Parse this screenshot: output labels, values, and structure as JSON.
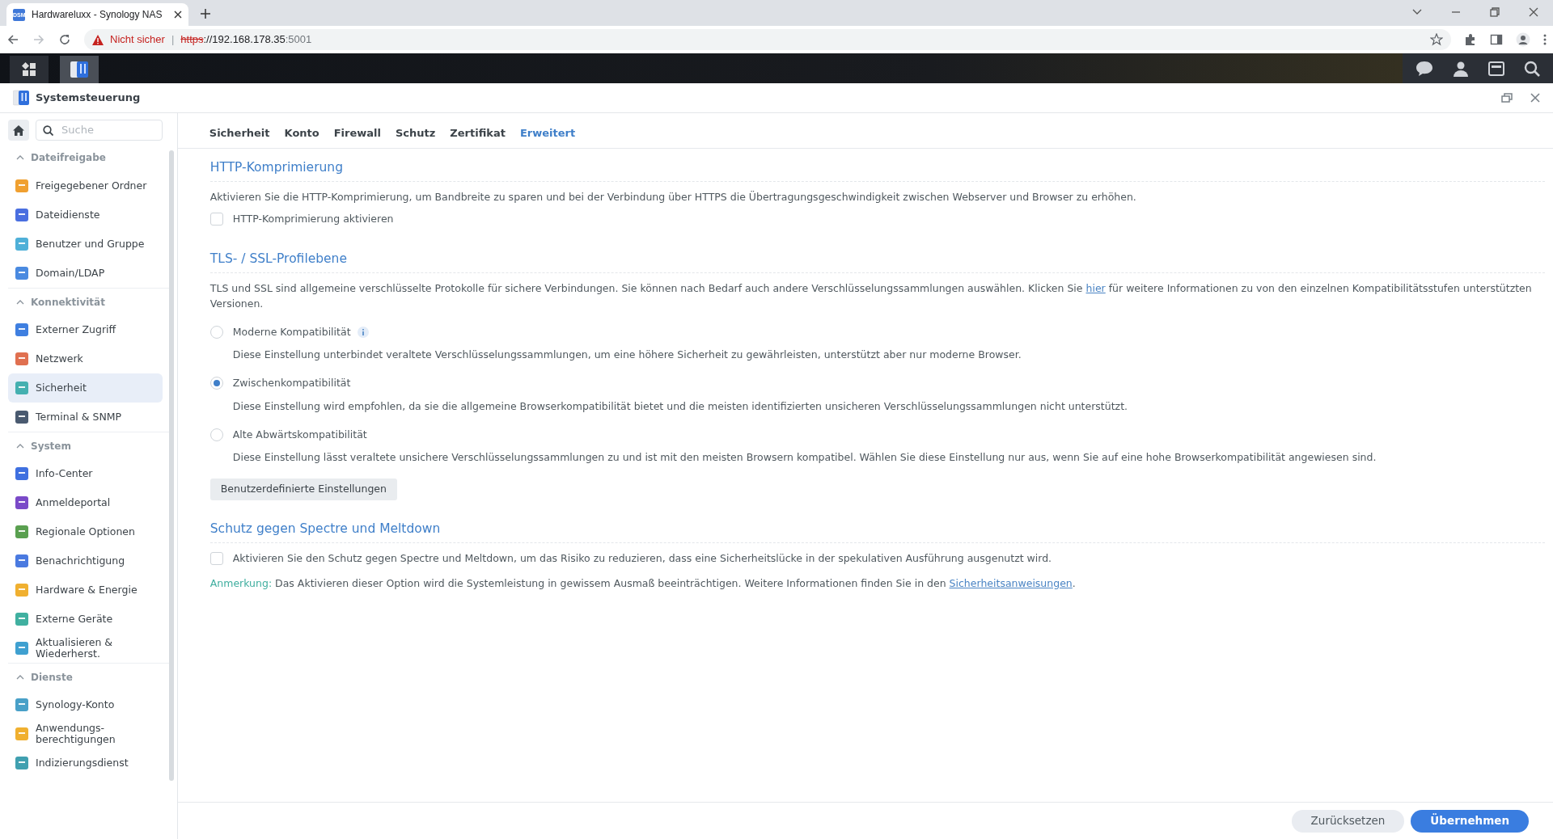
{
  "browser": {
    "tab": {
      "favicon": "DSM",
      "title": "Hardwareluxx - Synology NAS"
    },
    "address_bar": {
      "security_label": "Nicht sicher",
      "separator": "|",
      "url_scheme": "https",
      "url_host": "://192.168.178.35",
      "url_port": ":5001"
    }
  },
  "window": {
    "title": "Systemsteuerung"
  },
  "sidebar": {
    "search": {
      "placeholder": "Suche"
    },
    "sections": [
      {
        "title": "Dateifreigabe",
        "expanded": true,
        "items": [
          {
            "label": "Freigegebener Ordner",
            "selected": false
          },
          {
            "label": "Dateidienste",
            "selected": false
          },
          {
            "label": "Benutzer und Gruppe",
            "selected": false
          },
          {
            "label": "Domain/LDAP",
            "selected": false
          }
        ]
      },
      {
        "title": "Konnektivität",
        "expanded": true,
        "items": [
          {
            "label": "Externer Zugriff",
            "selected": false
          },
          {
            "label": "Netzwerk",
            "selected": false
          },
          {
            "label": "Sicherheit",
            "selected": true
          },
          {
            "label": "Terminal & SNMP",
            "selected": false
          }
        ]
      },
      {
        "title": "System",
        "expanded": true,
        "items": [
          {
            "label": "Info-Center",
            "selected": false
          },
          {
            "label": "Anmeldeportal",
            "selected": false
          },
          {
            "label": "Regionale Optionen",
            "selected": false
          },
          {
            "label": "Benachrichtigung",
            "selected": false
          },
          {
            "label": "Hardware & Energie",
            "selected": false
          },
          {
            "label": "Externe Geräte",
            "selected": false
          },
          {
            "label": "Aktualisieren & Wiederherst.",
            "selected": false
          }
        ]
      },
      {
        "title": "Dienste",
        "expanded": true,
        "items": [
          {
            "label": "Synology-Konto",
            "selected": false
          },
          {
            "label": "Anwendungs-berechtigungen",
            "selected": false
          },
          {
            "label": "Indizierungsdienst",
            "selected": false
          }
        ]
      }
    ]
  },
  "tabs": [
    {
      "label": "Sicherheit",
      "selected": false
    },
    {
      "label": "Konto",
      "selected": false
    },
    {
      "label": "Firewall",
      "selected": false
    },
    {
      "label": "Schutz",
      "selected": false
    },
    {
      "label": "Zertifikat",
      "selected": false
    },
    {
      "label": "Erweitert",
      "selected": true
    }
  ],
  "http_compression": {
    "title": "HTTP-Komprimierung",
    "description": "Aktivieren Sie die HTTP-Komprimierung, um Bandbreite zu sparen und bei der Verbindung über HTTPS die Übertragungsgeschwindigkeit zwischen Webserver und Browser zu erhöhen.",
    "checkbox": {
      "label": "HTTP-Komprimierung aktivieren",
      "checked": false
    }
  },
  "tls_profile": {
    "title": "TLS- / SSL-Profilebene",
    "description": {
      "before": "TLS und SSL sind allgemeine verschlüsselte Protokolle für sichere Verbindungen. Sie können nach Bedarf auch andere Verschlüsselungssammlungen auswählen. Klicken Sie ",
      "link": "hier",
      "after": " für weitere Informationen zu von den einzelnen Kompatibilitätsstufen unterstützten Versionen."
    },
    "options": [
      {
        "label": "Moderne Kompatibilität",
        "selected": false,
        "has_info": true,
        "description": "Diese Einstellung unterbindet veraltete Verschlüsselungssammlungen, um eine höhere Sicherheit zu gewährleisten, unterstützt aber nur moderne Browser."
      },
      {
        "label": "Zwischenkompatibilität",
        "selected": true,
        "has_info": false,
        "description": "Diese Einstellung wird empfohlen, da sie die allgemeine Browserkompatibilität bietet und die meisten identifizierten unsicheren Verschlüsselungssammlungen nicht unterstützt."
      },
      {
        "label": "Alte Abwärtskompatibilität",
        "selected": false,
        "has_info": false,
        "description": "Diese Einstellung lässt veraltete unsichere Verschlüsselungssammlungen zu und ist mit den meisten Browsern kompatibel. Wählen Sie diese Einstellung nur aus, wenn Sie auf eine hohe Browserkompatibilität angewiesen sind."
      }
    ],
    "custom_button": "Benutzerdefinierte Einstellungen"
  },
  "spectre": {
    "title": "Schutz gegen Spectre und Meltdown",
    "checkbox": {
      "label": "Aktivieren Sie den Schutz gegen Spectre und Meltdown, um das Risiko zu reduzieren, dass eine Sicherheitslücke in der spekulativen Ausführung ausgenutzt wird.",
      "checked": false
    },
    "note": {
      "label": "Anmerkung:",
      "before": " Das Aktivieren dieser Option wird die Systemleistung in gewissem Ausmaß beeinträchtigen. Weitere Informationen finden Sie in den ",
      "link": "Sicherheitsanweisungen",
      "after": "."
    }
  },
  "footer": {
    "buttons": [
      {
        "label": "Zurücksetzen",
        "kind": "secondary"
      },
      {
        "label": "Übernehmen",
        "kind": "primary"
      }
    ]
  }
}
